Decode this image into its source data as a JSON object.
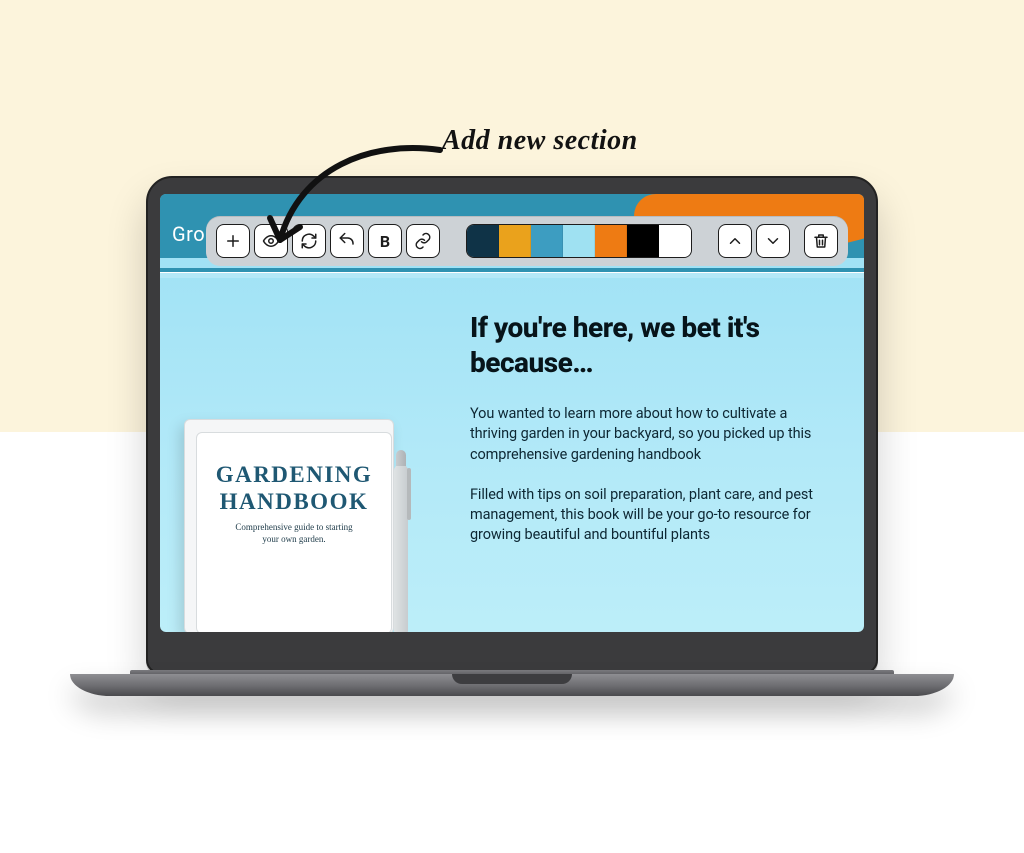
{
  "annotation": {
    "label": "Add new section"
  },
  "header": {
    "brand_fragment": "Gro"
  },
  "toolbar": {
    "items": [
      {
        "name": "add-section-button",
        "icon": "plus-icon"
      },
      {
        "name": "preview-button",
        "icon": "eye-icon"
      },
      {
        "name": "refresh-button",
        "icon": "refresh-icon"
      },
      {
        "name": "undo-button",
        "icon": "undo-icon"
      },
      {
        "name": "bold-button",
        "icon": "bold-icon"
      },
      {
        "name": "link-button",
        "icon": "link-icon"
      }
    ],
    "move": [
      {
        "name": "move-up-button",
        "icon": "chevron-up-icon"
      },
      {
        "name": "move-down-button",
        "icon": "chevron-down-icon"
      }
    ],
    "delete": {
      "name": "delete-section-button",
      "icon": "trash-icon"
    }
  },
  "palette": {
    "swatches": [
      "#0f3347",
      "#eaa21c",
      "#3d9dc1",
      "#9fe1f2",
      "#ee7b13",
      "#000000",
      "#ffffff"
    ]
  },
  "hero": {
    "title": "If you're here, we bet it's because…",
    "para1": "You wanted to learn more about how to cultivate a thriving garden in your backyard, so you picked up this comprehensive gardening handbook",
    "para2": "Filled with tips on soil preparation, plant care, and pest management, this book will be your go-to resource for growing beautiful and bountiful plants"
  },
  "book": {
    "title": "GARDENING HANDBOOK",
    "subtitle": "Comprehensive guide to starting your own garden."
  }
}
